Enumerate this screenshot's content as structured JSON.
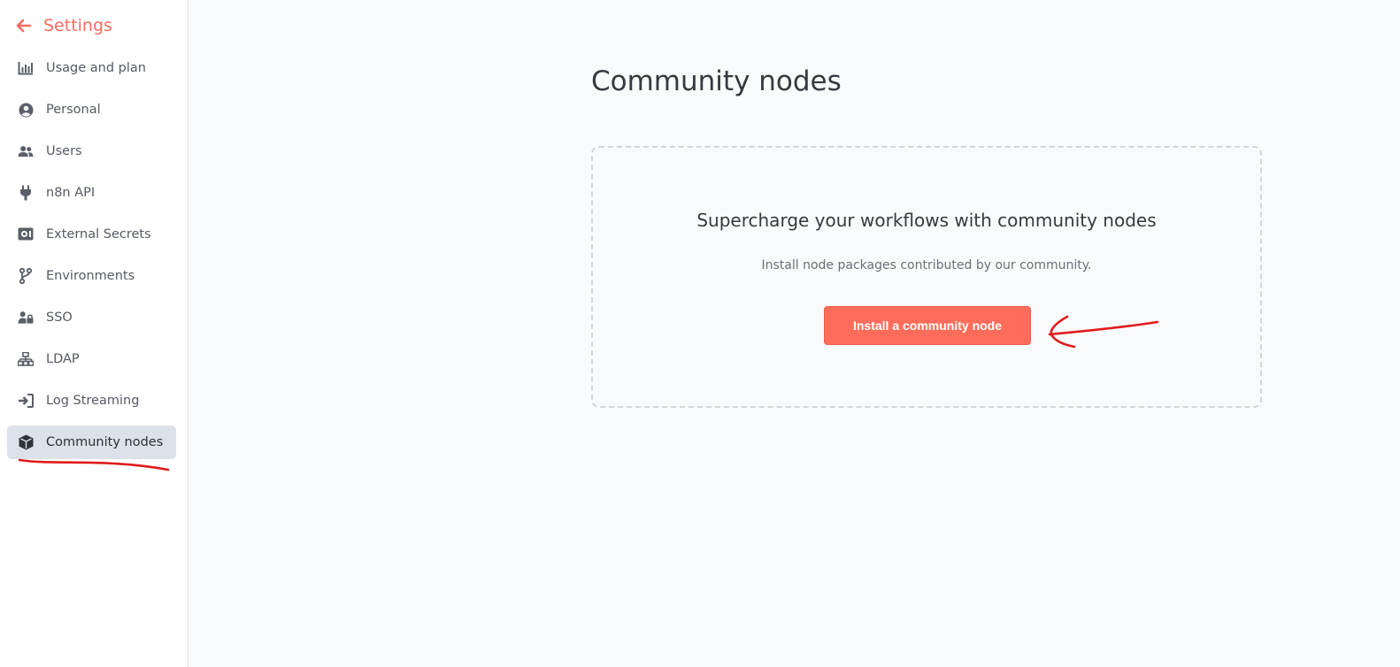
{
  "sidebar": {
    "back_label": "Settings",
    "items": [
      {
        "label": "Usage and plan",
        "icon": "chart-bar-icon"
      },
      {
        "label": "Personal",
        "icon": "user-circle-icon"
      },
      {
        "label": "Users",
        "icon": "users-icon"
      },
      {
        "label": "n8n API",
        "icon": "plug-icon"
      },
      {
        "label": "External Secrets",
        "icon": "vault-icon"
      },
      {
        "label": "Environments",
        "icon": "code-branch-icon"
      },
      {
        "label": "SSO",
        "icon": "user-lock-icon"
      },
      {
        "label": "LDAP",
        "icon": "network-icon"
      },
      {
        "label": "Log Streaming",
        "icon": "sign-in-icon"
      },
      {
        "label": "Community nodes",
        "icon": "cube-icon",
        "active": true
      }
    ]
  },
  "main": {
    "title": "Community nodes",
    "empty_state": {
      "heading": "Supercharge your workflows with community nodes",
      "description": "Install node packages contributed by our community.",
      "button_label": "Install a community node"
    }
  },
  "colors": {
    "accent": "#ff6d5a",
    "back_link": "#f76c5e",
    "active_item_bg": "#dde1e9",
    "annotation": "#e01b1b"
  }
}
